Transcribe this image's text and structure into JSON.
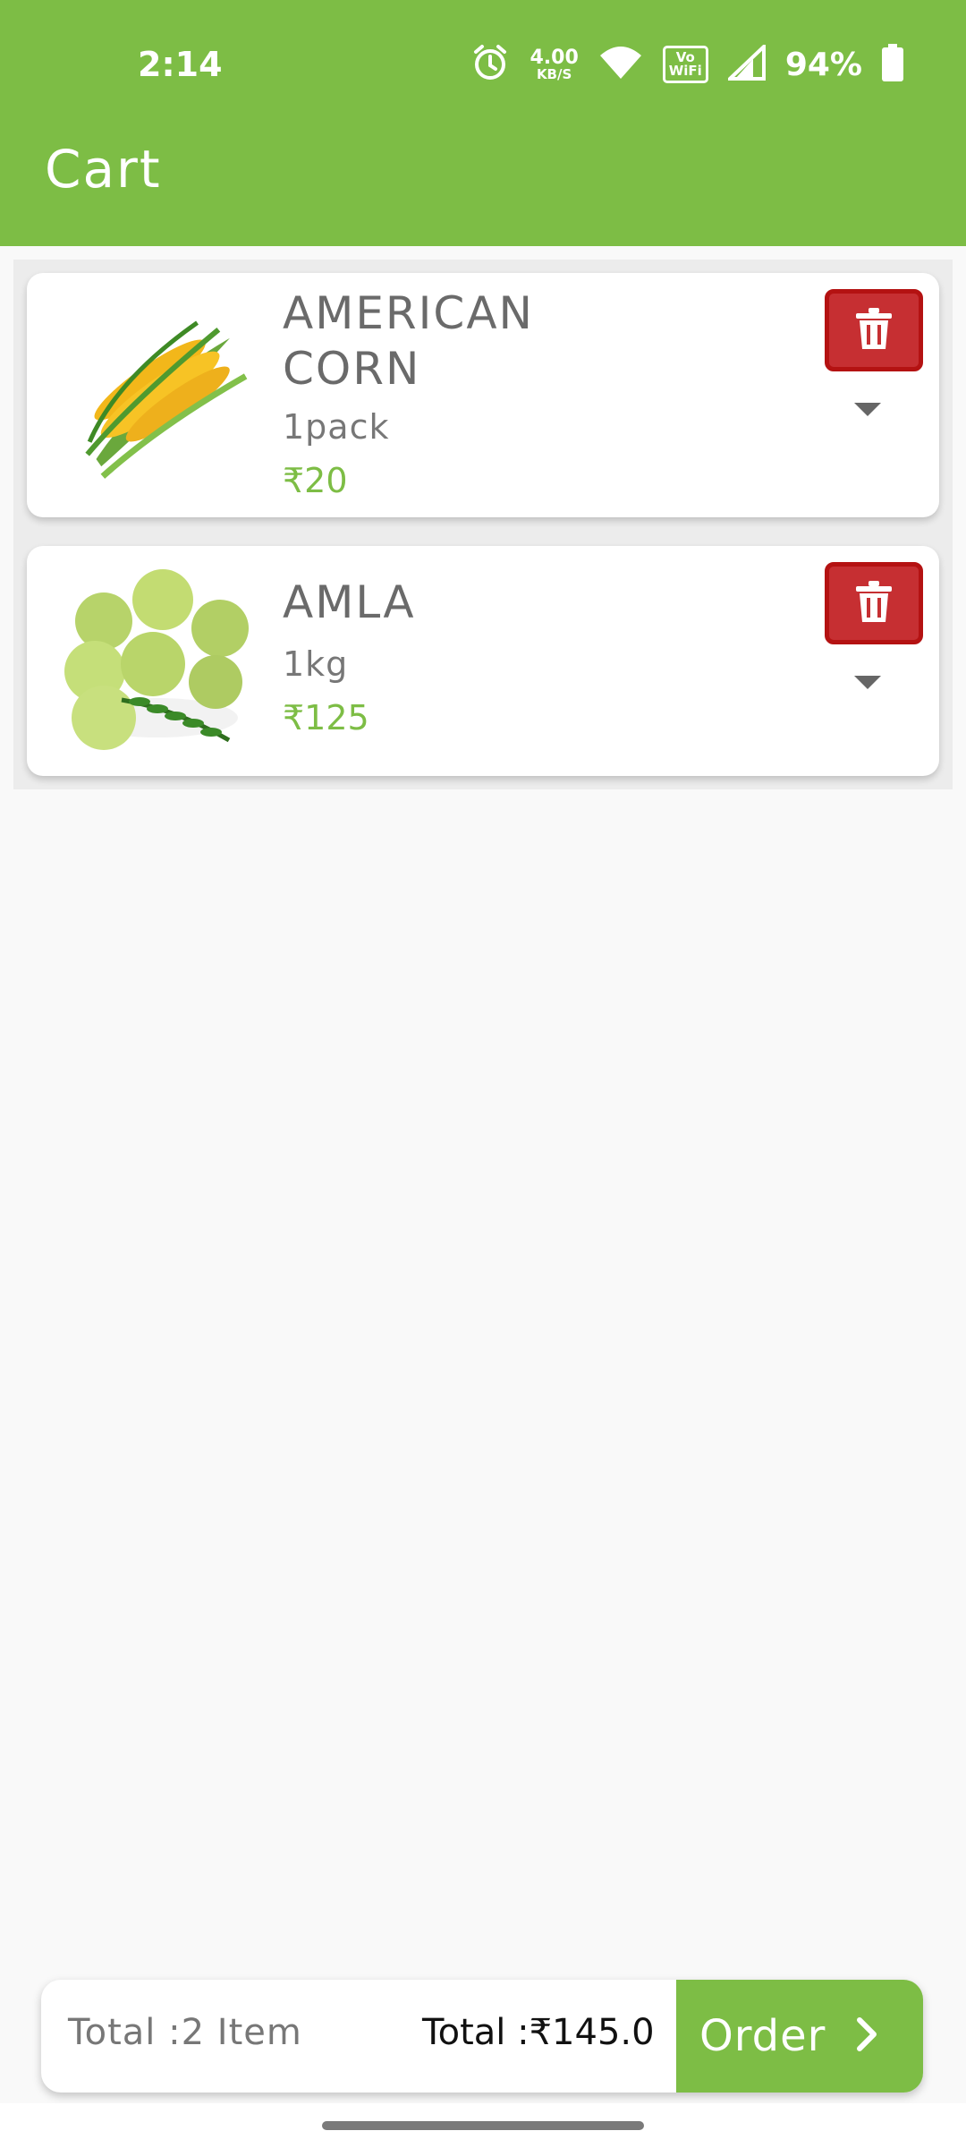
{
  "status_bar": {
    "time": "2:14",
    "speed_value": "4.00",
    "speed_unit": "KB/S",
    "vowifi_top": "Vo",
    "vowifi_bottom": "WiFi",
    "battery": "94%"
  },
  "header": {
    "title": "Cart"
  },
  "cart": {
    "items": [
      {
        "name_line1": "AMERICAN",
        "name_line2": "CORN",
        "quantity": "1pack",
        "price": "₹20",
        "image": "corn-image"
      },
      {
        "name_line1": "AMLA",
        "quantity": "1kg",
        "price": "₹125",
        "image": "amla-image"
      }
    ]
  },
  "footer": {
    "items_total": "Total :2 Item",
    "amount_total": "Total :₹145.0",
    "order_label": "Order"
  },
  "colors": {
    "brand_green": "#7dbd45",
    "delete_red": "#c62f32",
    "background": "#f9f9f9"
  }
}
